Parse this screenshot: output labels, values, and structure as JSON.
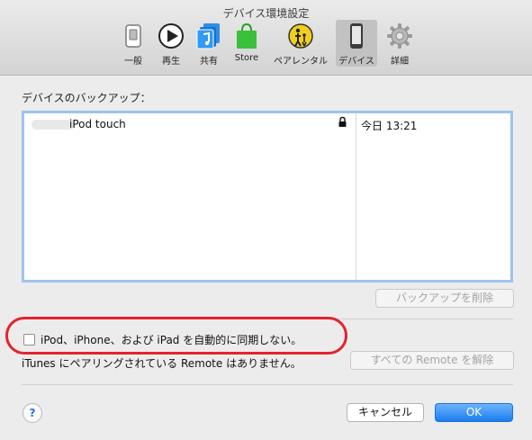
{
  "window": {
    "title": "デバイス環境設定"
  },
  "toolbar": {
    "items": [
      {
        "label": "一般",
        "icon": "switch-icon"
      },
      {
        "label": "再生",
        "icon": "play-icon"
      },
      {
        "label": "共有",
        "icon": "music-share-icon"
      },
      {
        "label": "Store",
        "icon": "shopping-bag-icon"
      },
      {
        "label": "ペアレンタル",
        "icon": "parental-icon"
      },
      {
        "label": "デバイス",
        "icon": "device-icon",
        "selected": true
      },
      {
        "label": "詳細",
        "icon": "gear-icon"
      }
    ]
  },
  "backup": {
    "section_title": "デバイスのバックアップ：",
    "rows": [
      {
        "device": "iPod touch",
        "date": "今日 13:21",
        "locked": true
      }
    ],
    "delete_button": "バックアップを削除"
  },
  "sync": {
    "checkbox_label": "iPod、iPhone、および iPad を自動的に同期しない。",
    "checked": false
  },
  "remote": {
    "status_text": "iTunes にペアリングされている Remote はありません。",
    "unpair_button": "すべての Remote を解除"
  },
  "footer": {
    "help_label": "?",
    "cancel_label": "キャンセル",
    "ok_label": "OK"
  },
  "colors": {
    "accent": "#1b7df2",
    "highlight": "#e4232e",
    "selection_border": "#9ec4ee"
  }
}
